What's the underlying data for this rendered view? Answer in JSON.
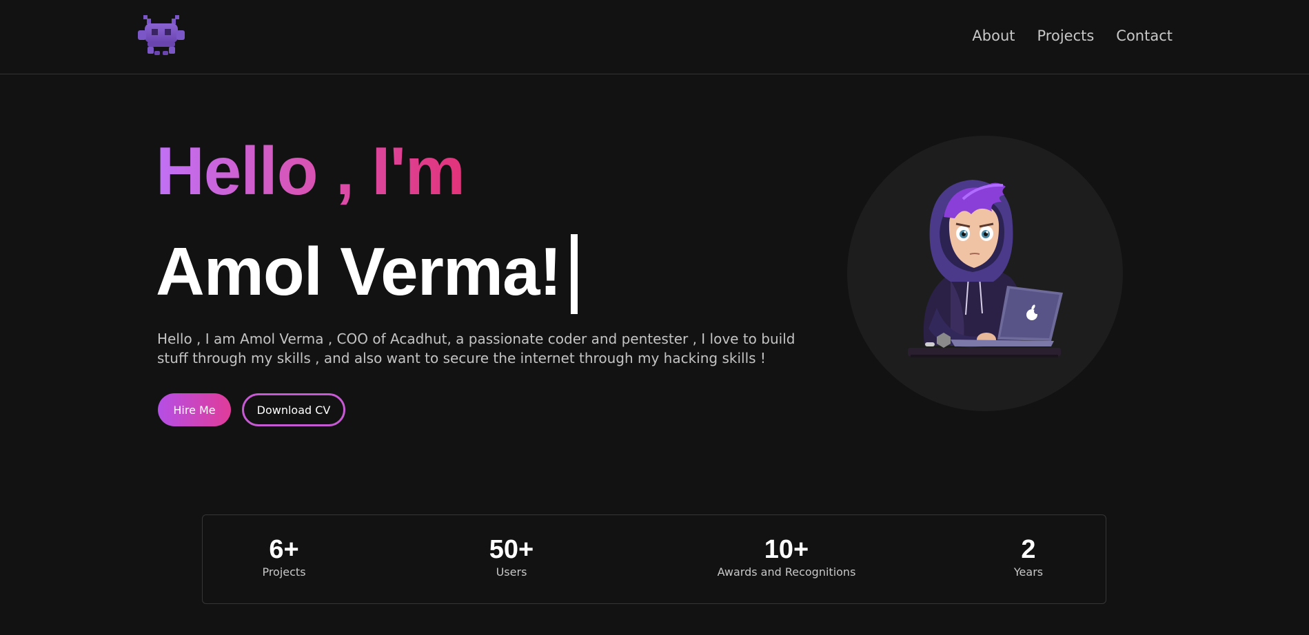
{
  "nav": {
    "logo_icon": "space-invader-icon",
    "links": [
      "About",
      "Projects",
      "Contact"
    ]
  },
  "hero": {
    "greeting": "Hello , I'm",
    "name": "Amol Verma!",
    "description": "Hello , I am Amol Verma , COO of Acadhut, a passionate coder and pentester , I love to build stuff through my skills , and also want to secure the internet through my hacking skills !",
    "hire_label": "Hire Me",
    "cv_label": "Download CV",
    "avatar_icon": "hacker-avatar-illustration"
  },
  "stats": [
    {
      "value": "6+",
      "label": "Projects"
    },
    {
      "value": "50+",
      "label": "Users"
    },
    {
      "value": "10+",
      "label": "Awards and Recognitions"
    },
    {
      "value": "2",
      "label": "Years"
    }
  ],
  "colors": {
    "background": "#121212",
    "gradient_start": "#c071f7",
    "gradient_end": "#e2337a",
    "accent_purple": "#7a4fc4"
  }
}
